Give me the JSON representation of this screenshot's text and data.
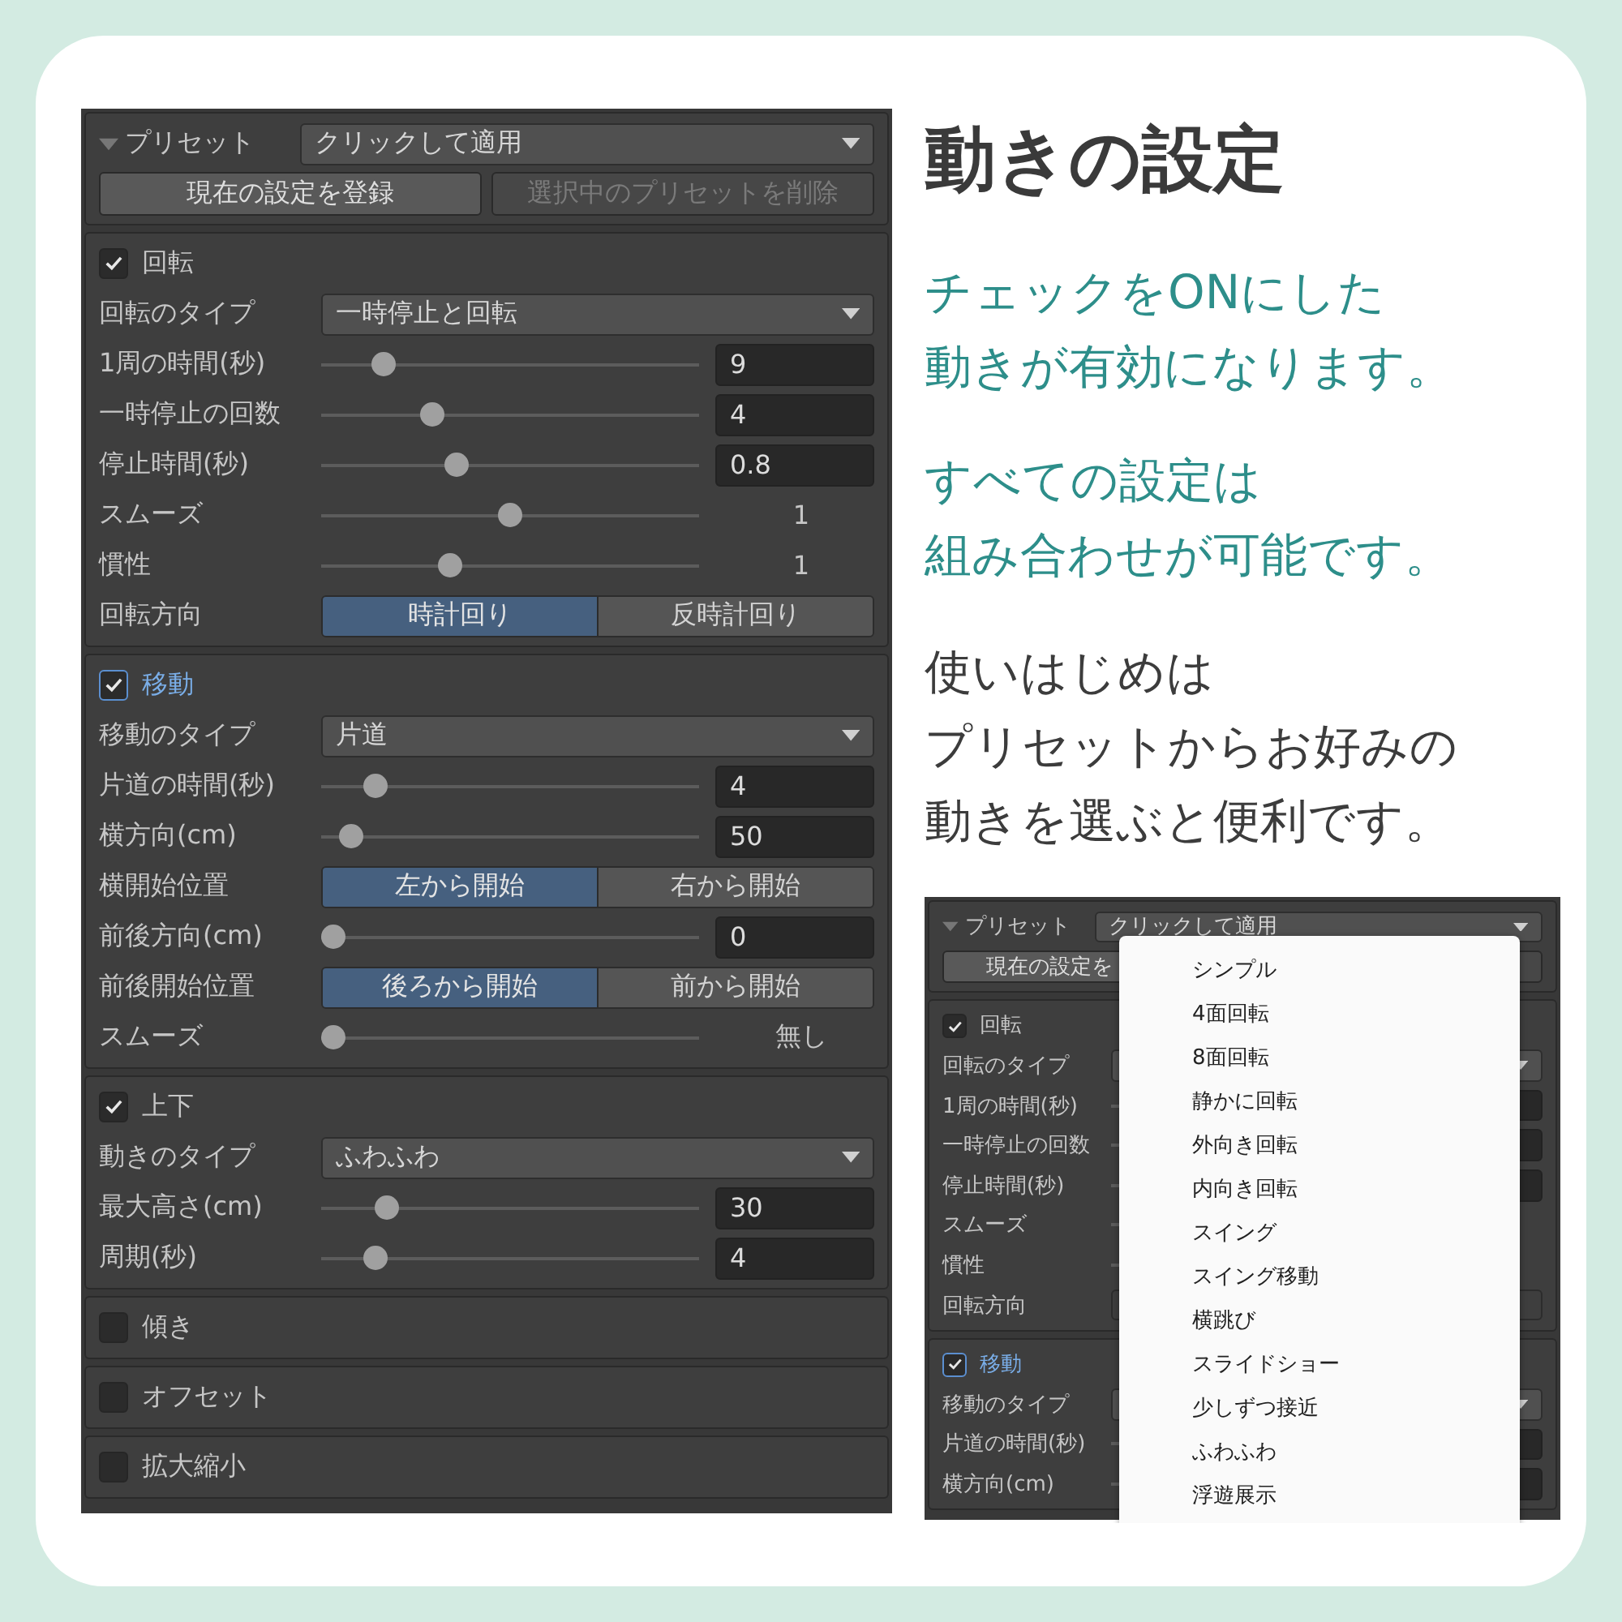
{
  "heading": "動きの設定",
  "notes": [
    {
      "kind": "accent",
      "lines": [
        "チェックをONにした",
        "動きが有効になります。"
      ]
    },
    {
      "kind": "accent",
      "lines": [
        "すべての設定は",
        "組み合わせが可能です。"
      ]
    },
    {
      "kind": "plain",
      "lines": [
        "使いはじめは",
        "プリセットからお好みの",
        "動きを選ぶと便利です。"
      ]
    }
  ],
  "panel": {
    "preset": {
      "label": "プリセット",
      "value": "クリックして適用",
      "expanded": true
    },
    "buttons": [
      {
        "label": "現在の設定を登録",
        "disabled": false
      },
      {
        "label": "選択中のプリセットを削除",
        "disabled": true
      }
    ],
    "sections": [
      {
        "title": "回転",
        "checked": true,
        "focused": false,
        "rows": [
          {
            "kind": "dropdown",
            "label": "回転のタイプ",
            "value": "一時停止と回転"
          },
          {
            "kind": "slider_input",
            "label": "1周の時間(秒)",
            "level": 0.14,
            "value": "9"
          },
          {
            "kind": "slider_input",
            "label": "一時停止の回数",
            "level": 0.28,
            "value": "4"
          },
          {
            "kind": "slider_input",
            "label": "停止時間(秒)",
            "level": 0.35,
            "value": "0.8"
          },
          {
            "kind": "slider_reading",
            "label": "スムーズ",
            "level": 0.5,
            "value": "1"
          },
          {
            "kind": "slider_reading",
            "label": "慣性",
            "level": 0.33,
            "value": "1"
          },
          {
            "kind": "toggle",
            "label": "回転方向",
            "options": [
              {
                "label": "時計回り",
                "selected": true
              },
              {
                "label": "反時計回り",
                "selected": false
              }
            ]
          }
        ]
      },
      {
        "title": "移動",
        "checked": true,
        "focused": true,
        "rows": [
          {
            "kind": "dropdown",
            "label": "移動のタイプ",
            "value": "片道"
          },
          {
            "kind": "slider_input",
            "label": "片道の時間(秒)",
            "level": 0.12,
            "value": "4"
          },
          {
            "kind": "slider_input",
            "label": "横方向(cm)",
            "level": 0.05,
            "value": "50"
          },
          {
            "kind": "toggle",
            "label": "横開始位置",
            "options": [
              {
                "label": "左から開始",
                "selected": true
              },
              {
                "label": "右から開始",
                "selected": false
              }
            ]
          },
          {
            "kind": "slider_input",
            "label": "前後方向(cm)",
            "level": 0,
            "value": "0"
          },
          {
            "kind": "toggle",
            "label": "前後開始位置",
            "options": [
              {
                "label": "後ろから開始",
                "selected": true
              },
              {
                "label": "前から開始",
                "selected": false
              }
            ]
          },
          {
            "kind": "slider_reading",
            "label": "スムーズ",
            "level": 0,
            "value": "無し"
          }
        ]
      },
      {
        "title": "上下",
        "checked": true,
        "focused": false,
        "rows": [
          {
            "kind": "dropdown",
            "label": "動きのタイプ",
            "value": "ふわふわ"
          },
          {
            "kind": "slider_input",
            "label": "最大高さ(cm)",
            "level": 0.15,
            "value": "30"
          },
          {
            "kind": "slider_input",
            "label": "周期(秒)",
            "level": 0.12,
            "value": "4"
          }
        ]
      },
      {
        "title": "傾き",
        "checked": false,
        "focused": false
      },
      {
        "title": "オフセット",
        "checked": false,
        "focused": false
      },
      {
        "title": "拡大縮小",
        "checked": false,
        "focused": false
      }
    ]
  },
  "mini": {
    "preset": {
      "label": "プリセット",
      "value": "クリックして適用",
      "expanded": true
    },
    "buttons": [
      {
        "label": "現在の設定を",
        "disabled": false
      },
      {
        "disabled": true
      }
    ],
    "sections": [
      {
        "title": "回転",
        "checked": true,
        "focused": false,
        "rows": [
          {
            "kind": "dropdown",
            "label": "回転のタイプ"
          },
          {
            "kind": "slider_input",
            "label": "1周の時間(秒)"
          },
          {
            "kind": "slider_input",
            "label": "一時停止の回数"
          },
          {
            "kind": "slider_input",
            "label": "停止時間(秒)"
          },
          {
            "kind": "slider_reading",
            "label": "スムーズ"
          },
          {
            "kind": "slider_reading",
            "label": "慣性"
          },
          {
            "kind": "toggle",
            "label": "回転方向"
          }
        ]
      },
      {
        "title": "移動",
        "checked": true,
        "focused": true,
        "rows": [
          {
            "kind": "dropdown",
            "label": "移動のタイプ"
          },
          {
            "kind": "slider_input",
            "label": "片道の時間(秒)"
          },
          {
            "kind": "slider_input",
            "label": "横方向(cm)"
          }
        ]
      }
    ],
    "menu": {
      "items": [
        "シンプル",
        "4面回転",
        "8面回転",
        "静かに回転",
        "外向き回転",
        "内向き回転",
        "スイング",
        "スイング移動",
        "横跳び",
        "スライドショー",
        "少しずつ接近",
        "ふわふわ",
        "浮遊展示"
      ]
    }
  }
}
